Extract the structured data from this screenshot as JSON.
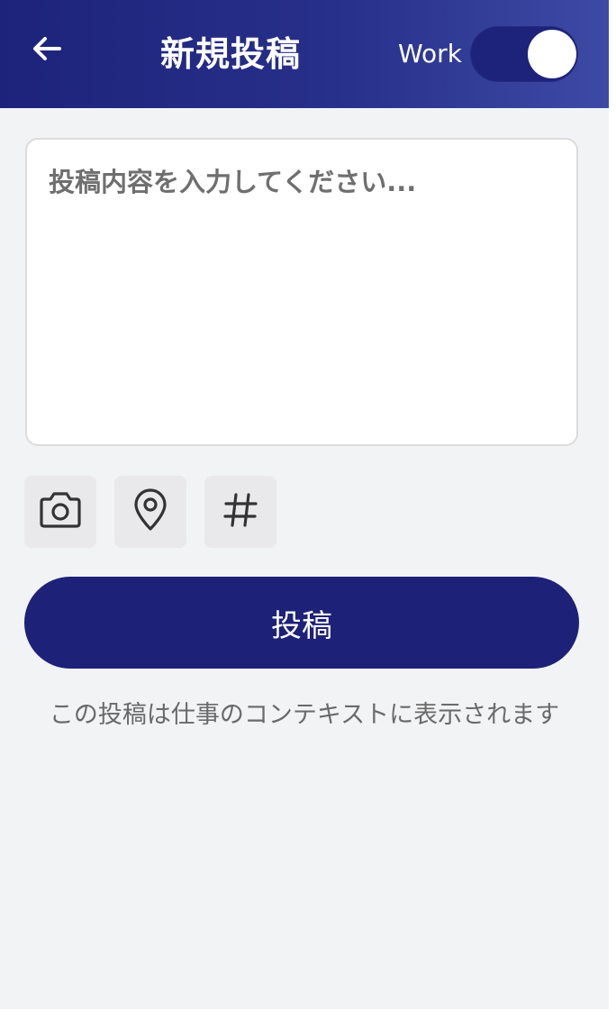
{
  "header": {
    "title": "新規投稿",
    "back_icon": "arrow-left-icon",
    "mode_label": "Work",
    "mode_toggle_on": true,
    "gradient_start": "#1d237a",
    "gradient_end": "#3d4aa5"
  },
  "composer": {
    "placeholder": "投稿内容を入力してください...",
    "value": ""
  },
  "tools": [
    {
      "icon": "camera-icon"
    },
    {
      "icon": "location-pin-icon"
    },
    {
      "icon": "hashtag-icon"
    }
  ],
  "submit": {
    "label": "投稿",
    "color": "#1d2178"
  },
  "context_note": "この投稿は仕事のコンテキストに表示されます",
  "colors": {
    "background": "#f2f3f5",
    "tool_background": "#e9e9eb",
    "note_text": "#6a6a6a"
  }
}
